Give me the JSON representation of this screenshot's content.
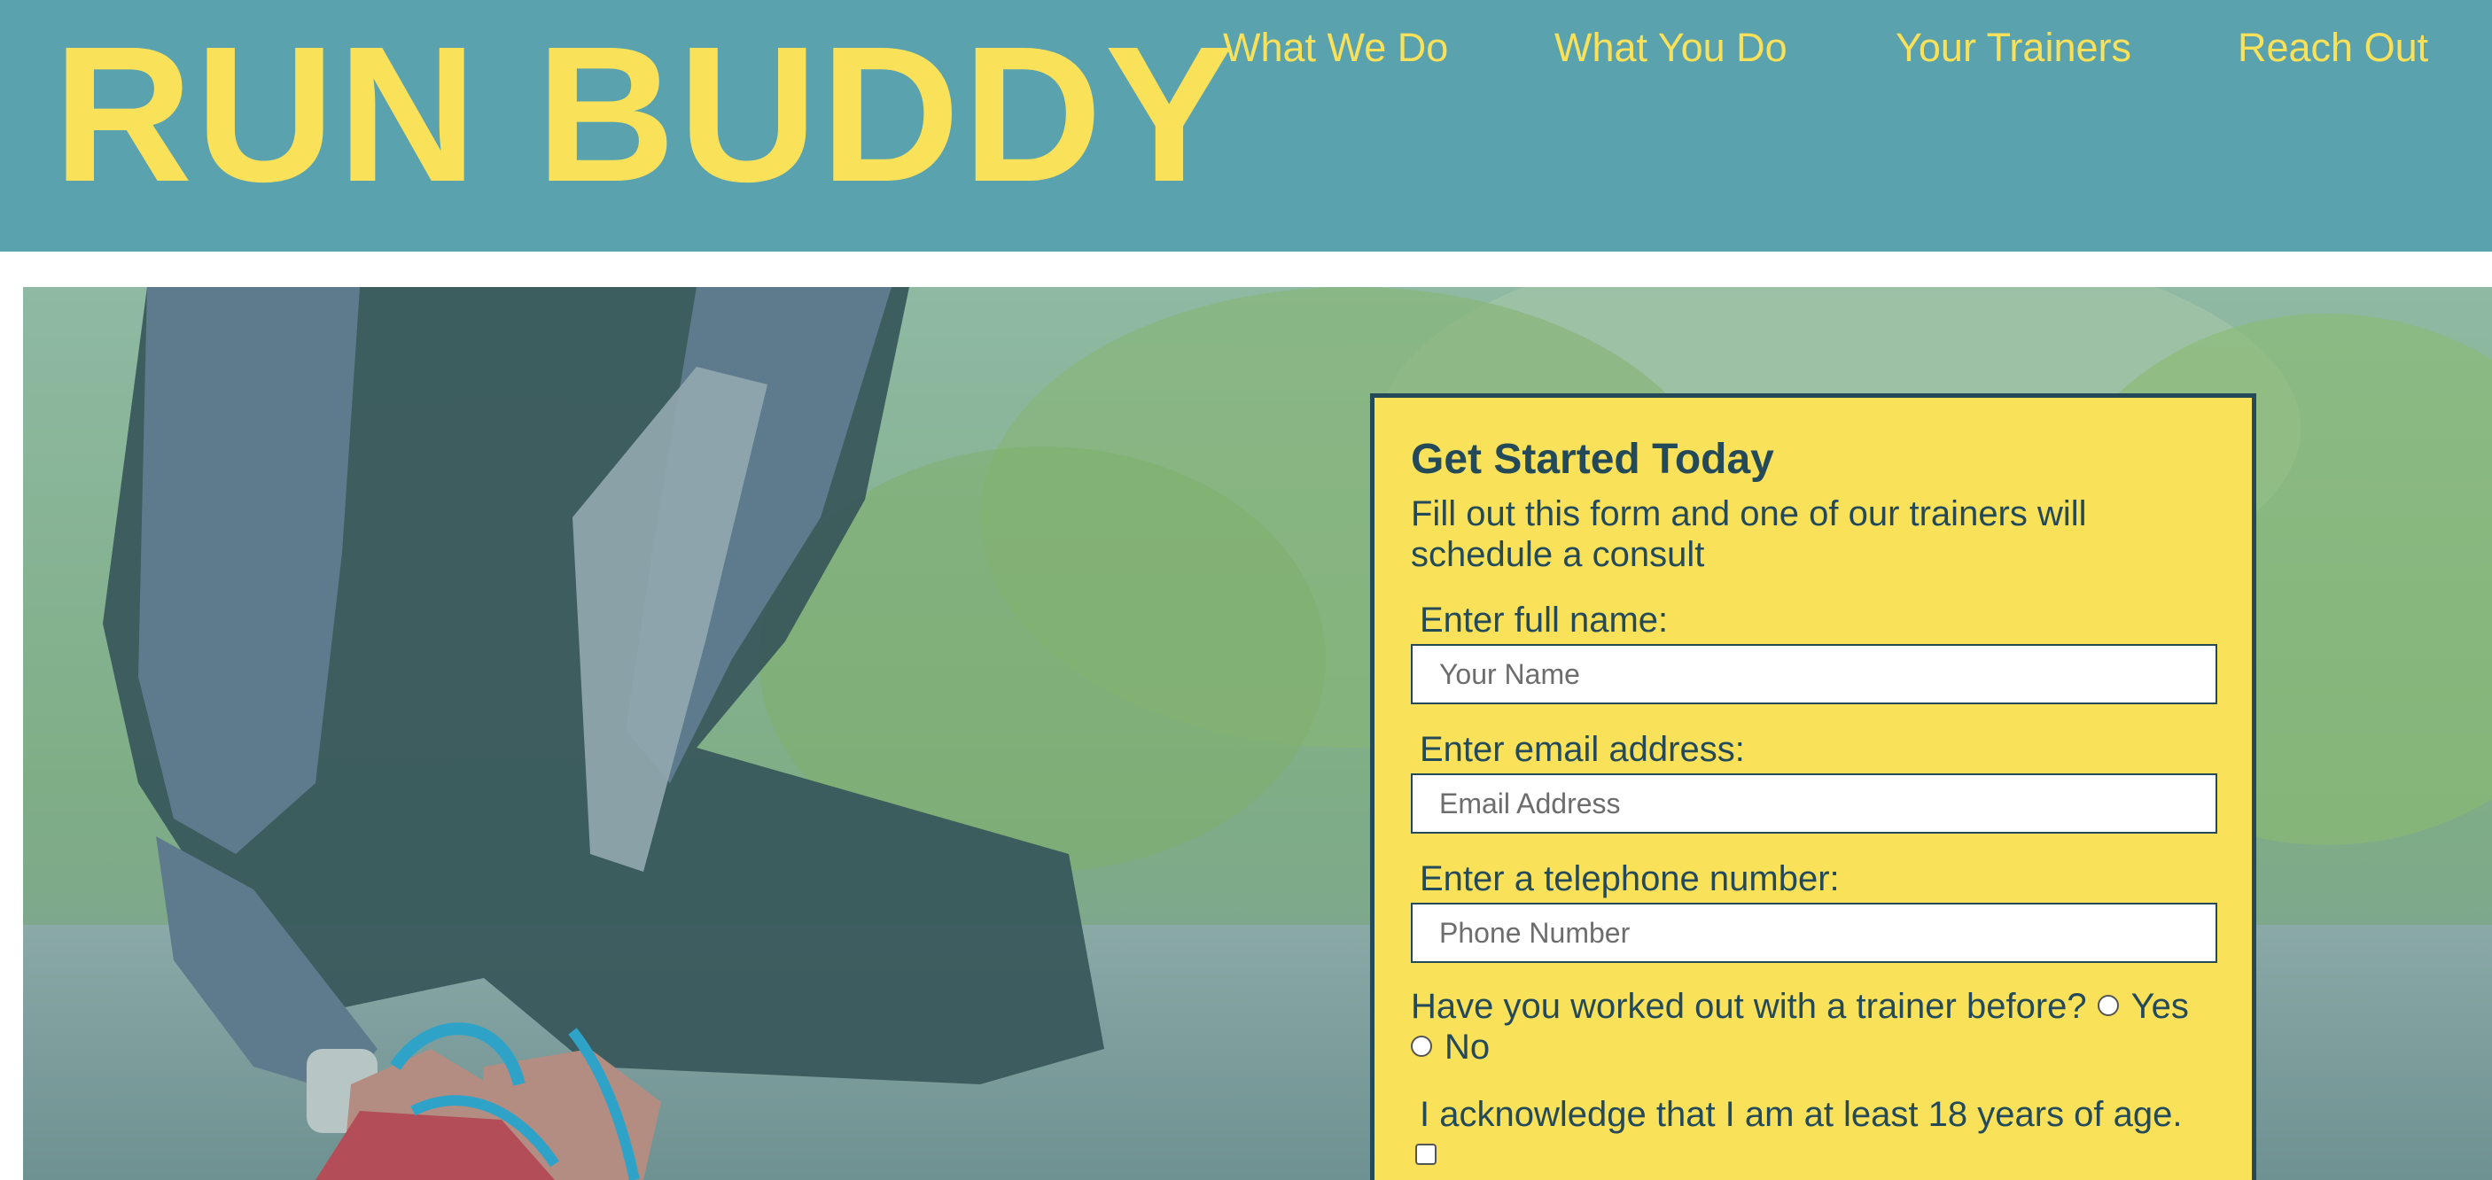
{
  "brand": {
    "logo": "RUN BUDDY"
  },
  "nav": {
    "items": [
      {
        "label": "What We Do"
      },
      {
        "label": "What You Do"
      },
      {
        "label": "Your Trainers"
      },
      {
        "label": "Reach Out"
      }
    ]
  },
  "hero": {
    "image": "runner-tying-shoe-photo"
  },
  "form": {
    "title": "Get Started Today",
    "subtitle": "Fill out this form and one of our trainers will schedule a consult",
    "fields": [
      {
        "label": "Enter full name:",
        "placeholder": "Your Name"
      },
      {
        "label": "Enter email address:",
        "placeholder": "Email Address"
      },
      {
        "label": "Enter a telephone number:",
        "placeholder": "Phone Number"
      }
    ],
    "trainer_question": "Have you worked out with a trainer before?",
    "option_yes": "Yes",
    "option_no": "No",
    "acknowledge": "I acknowledge that I am at least 18 years of age."
  },
  "colors": {
    "header_bg": "#5aa2ae",
    "accent_yellow": "#f9e15a",
    "text_dark": "#244a5a"
  }
}
